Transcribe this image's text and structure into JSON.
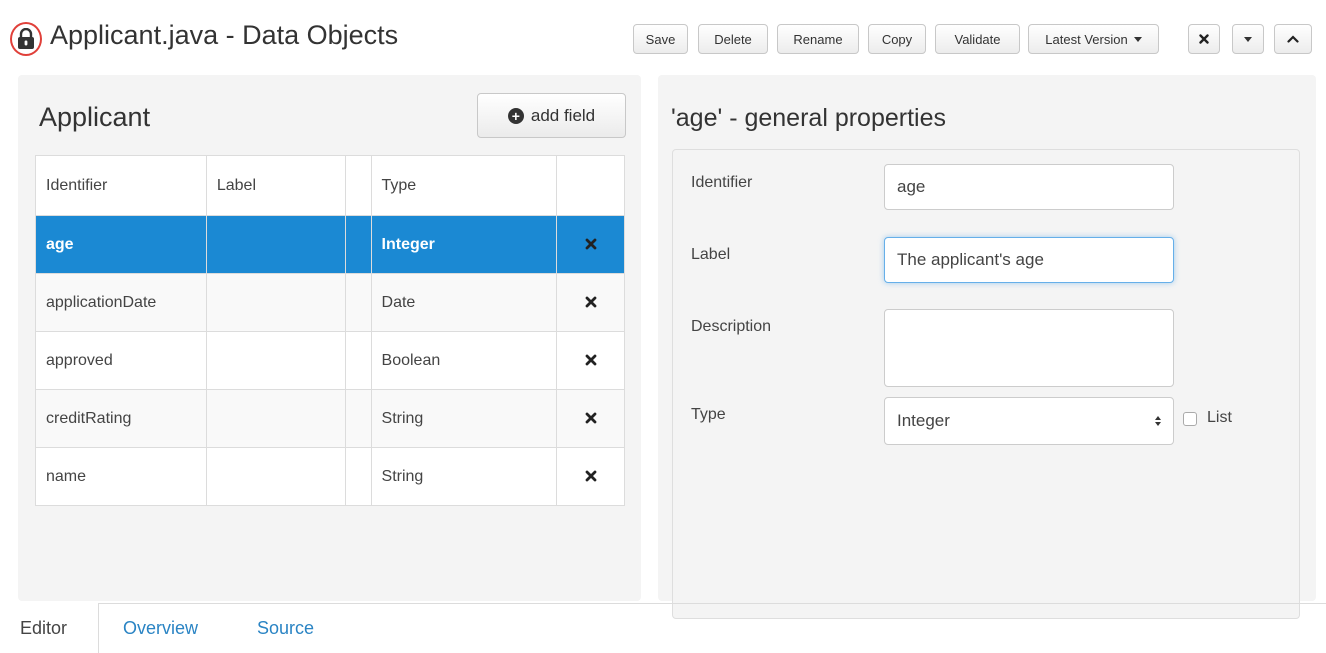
{
  "window": {
    "title": "Applicant.java - Data Objects",
    "lock_icon": "lock-icon"
  },
  "toolbar": {
    "save": "Save",
    "delete": "Delete",
    "rename": "Rename",
    "copy": "Copy",
    "validate": "Validate",
    "latest_version": "Latest Version",
    "close_icon": "close-icon",
    "collapse_icon": "chevron-down-icon",
    "maximize_icon": "chevron-up-icon"
  },
  "object": {
    "title": "Applicant",
    "add_field": "add field",
    "columns": [
      "Identifier",
      "Label",
      "",
      "Type",
      ""
    ],
    "fields": [
      {
        "identifier": "age",
        "label": "",
        "type": "Integer",
        "selected": true
      },
      {
        "identifier": "applicationDate",
        "label": "",
        "type": "Date",
        "selected": false
      },
      {
        "identifier": "approved",
        "label": "",
        "type": "Boolean",
        "selected": false
      },
      {
        "identifier": "creditRating",
        "label": "",
        "type": "String",
        "selected": false
      },
      {
        "identifier": "name",
        "label": "",
        "type": "String",
        "selected": false
      }
    ]
  },
  "properties": {
    "title": "'age' - general properties",
    "identifier_label": "Identifier",
    "identifier_value": "age",
    "label_label": "Label",
    "label_value": "The applicant's age",
    "description_label": "Description",
    "description_value": "",
    "type_label": "Type",
    "type_value": "Integer",
    "list_label": "List",
    "list_checked": false
  },
  "tabs": [
    "Editor",
    "Overview",
    "Source"
  ],
  "colors": {
    "selected_row": "#1b89d3",
    "link": "#2a84c4",
    "lock_highlight": "#e0403a"
  }
}
